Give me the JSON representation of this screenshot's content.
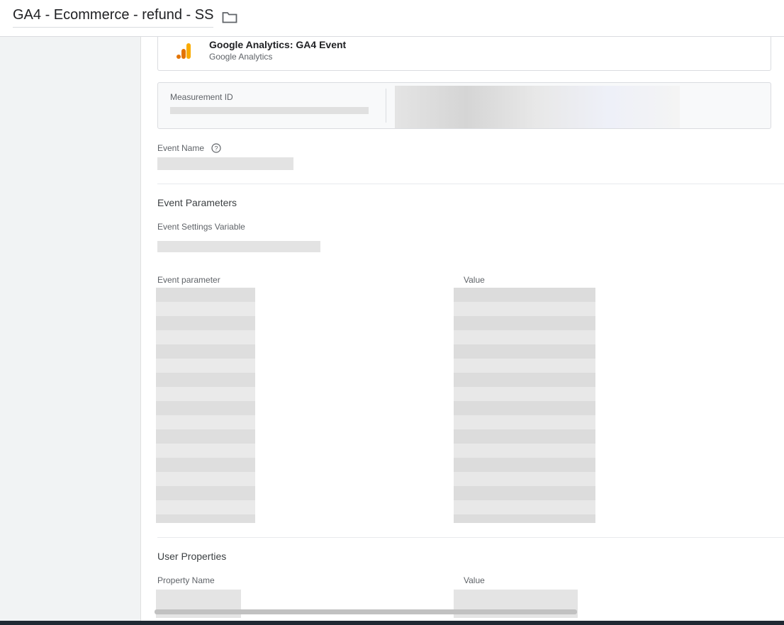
{
  "header": {
    "title": "GA4 - Ecommerce - refund - SS",
    "folder_icon": "folder-icon"
  },
  "tag_type": {
    "name": "Google Analytics: GA4 Event",
    "vendor": "Google Analytics",
    "icon": "google-analytics-icon",
    "logo_colors": [
      "#f9ab00",
      "#e37400"
    ]
  },
  "measurement": {
    "label": "Measurement ID"
  },
  "event_name": {
    "label": "Event Name",
    "help_icon": "help-circle-icon"
  },
  "event_parameters": {
    "section_title": "Event Parameters",
    "settings_variable_label": "Event Settings Variable",
    "col_parameter": "Event parameter",
    "col_value": "Value"
  },
  "user_properties": {
    "section_title": "User Properties",
    "col_property": "Property Name",
    "col_value": "Value"
  }
}
